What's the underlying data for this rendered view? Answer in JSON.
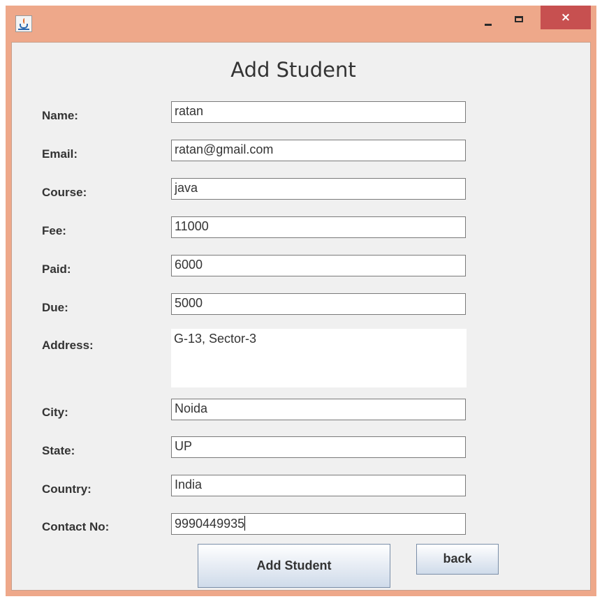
{
  "window": {
    "title": "",
    "app_icon": "java-coffee-cup-icon",
    "controls": {
      "minimize": "minimize-icon",
      "maximize": "maximize-icon",
      "close": "×"
    },
    "titlebar_color": "#eea88a",
    "close_button_color": "#c75050"
  },
  "form": {
    "title": "Add Student",
    "fields": {
      "name": {
        "label": "Name:",
        "value": "ratan"
      },
      "email": {
        "label": "Email:",
        "value": "ratan@gmail.com"
      },
      "course": {
        "label": "Course:",
        "value": "java"
      },
      "fee": {
        "label": "Fee:",
        "value": "11000"
      },
      "paid": {
        "label": "Paid:",
        "value": "6000"
      },
      "due": {
        "label": "Due:",
        "value": "5000"
      },
      "address": {
        "label": "Address:",
        "value": "G-13, Sector-3"
      },
      "city": {
        "label": "City:",
        "value": "Noida"
      },
      "state": {
        "label": "State:",
        "value": "UP"
      },
      "country": {
        "label": "Country:",
        "value": "India"
      },
      "contact": {
        "label": "Contact No:",
        "value": "9990449935"
      }
    },
    "buttons": {
      "add_label": "Add Student",
      "back_label": "back"
    }
  }
}
